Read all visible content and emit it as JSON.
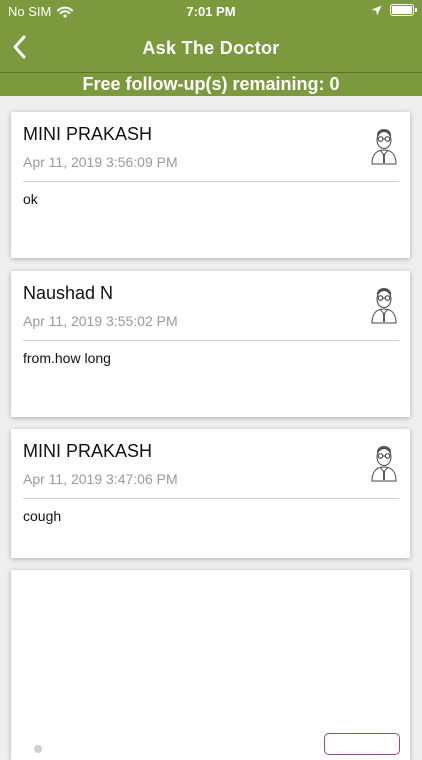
{
  "status_bar": {
    "carrier": "No SIM",
    "time": "7:01 PM"
  },
  "nav": {
    "title": "Ask The Doctor"
  },
  "followup": {
    "text": "Free follow-up(s) remaining: 0"
  },
  "messages": [
    {
      "name": "MINI PRAKASH",
      "date": "Apr 11, 2019 3:56:09 PM",
      "text": "ok"
    },
    {
      "name": "Naushad N",
      "date": "Apr 11, 2019 3:55:02 PM",
      "text": "from.how long"
    },
    {
      "name": "MINI PRAKASH",
      "date": "Apr 11, 2019 3:47:06 PM",
      "text": "cough"
    }
  ],
  "colors": {
    "brand_green": "#7c9a3d",
    "chip_border": "#8a4f8a"
  },
  "icons": [
    "wifi-icon",
    "back-chevron-icon",
    "location-arrow-icon",
    "battery-icon",
    "doctor-avatar-icon"
  ]
}
